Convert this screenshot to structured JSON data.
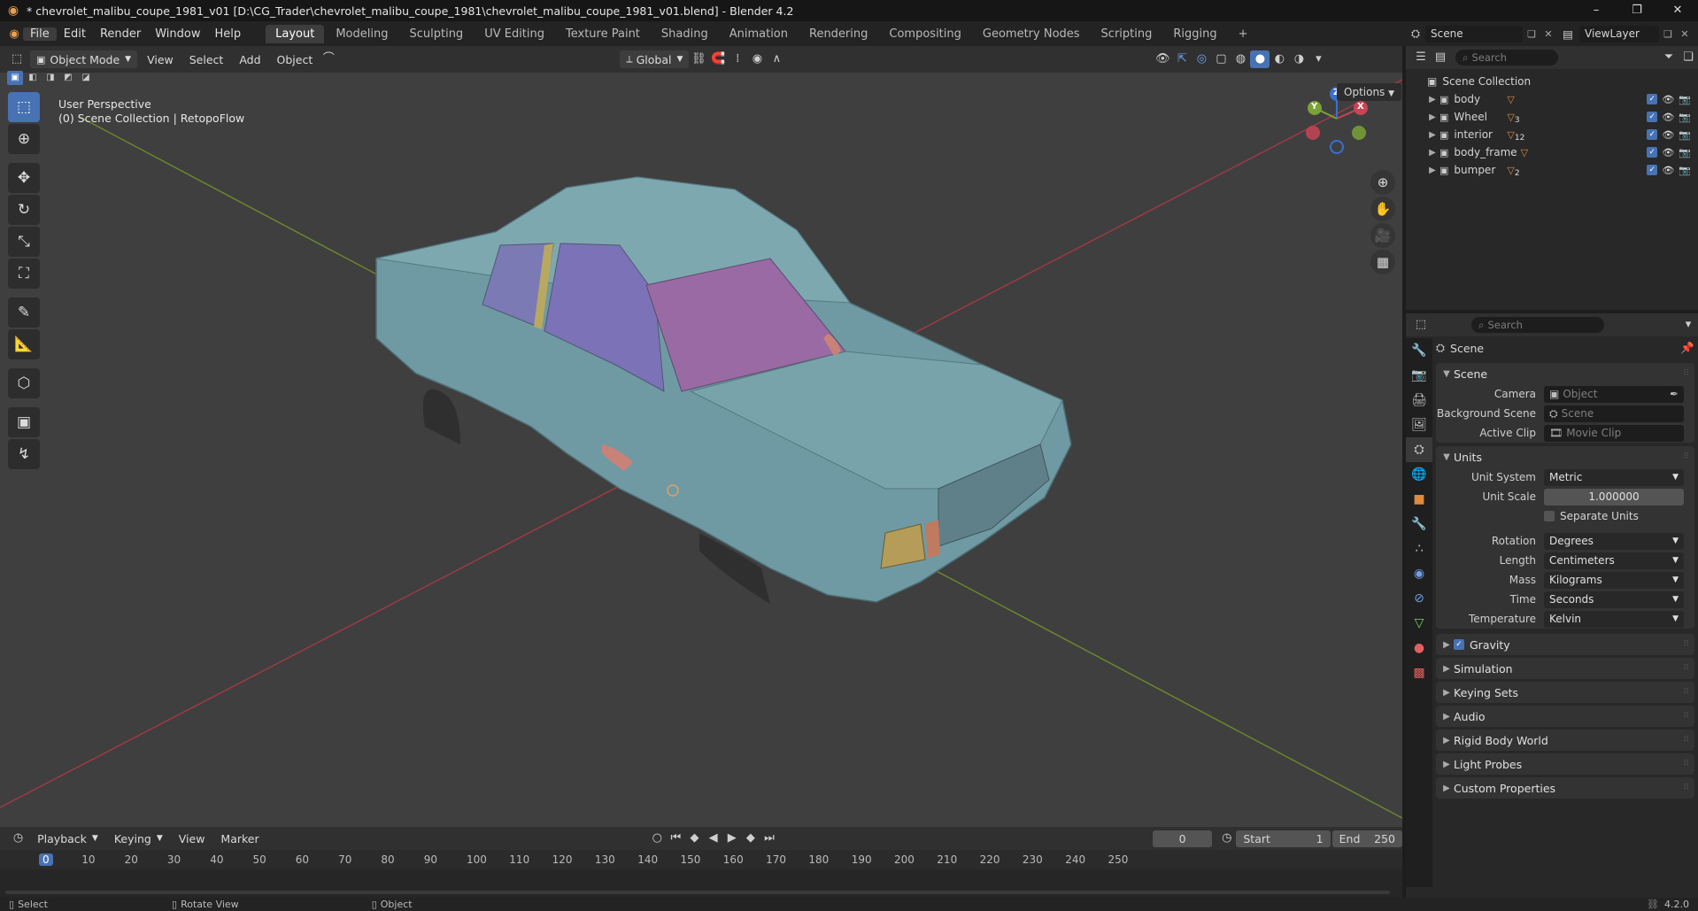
{
  "window": {
    "title": "* chevrolet_malibu_coupe_1981_v01 [D:\\CG_Trader\\chevrolet_malibu_coupe_1981\\chevrolet_malibu_coupe_1981_v01.blend] - Blender 4.2",
    "minimize": "–",
    "maximize": "❐",
    "close": "✕"
  },
  "menu": {
    "file": "File",
    "edit": "Edit",
    "render": "Render",
    "window": "Window",
    "help": "Help"
  },
  "workspaces": [
    "Layout",
    "Modeling",
    "Sculpting",
    "UV Editing",
    "Texture Paint",
    "Shading",
    "Animation",
    "Rendering",
    "Compositing",
    "Geometry Nodes",
    "Scripting",
    "Rigging"
  ],
  "workspace_add": "+",
  "scene_selector": {
    "scene": "Scene",
    "viewlayer": "ViewLayer"
  },
  "viewport_header": {
    "mode": "Object Mode",
    "view": "View",
    "select": "Select",
    "add": "Add",
    "object": "Object",
    "orientation": "Global",
    "options": "Options"
  },
  "overlay": {
    "perspective": "User Perspective",
    "collection": "(0) Scene Collection | RetopoFlow"
  },
  "gizmo": {
    "x": "X",
    "y": "Y",
    "z": "Z"
  },
  "outliner": {
    "search_placeholder": "Search",
    "root": "Scene Collection",
    "items": [
      {
        "name": "body",
        "badge": ""
      },
      {
        "name": "Wheel",
        "badge": "3"
      },
      {
        "name": "interior",
        "badge": "12"
      },
      {
        "name": "body_frame",
        "badge": ""
      },
      {
        "name": "bumper",
        "badge": "2"
      }
    ]
  },
  "properties": {
    "search_placeholder": "Search",
    "context": "Scene",
    "scene_panel": "Scene",
    "camera_label": "Camera",
    "camera_placeholder": "Object",
    "bgscene_label": "Background Scene",
    "bgscene_placeholder": "Scene",
    "clip_label": "Active Clip",
    "clip_placeholder": "Movie Clip",
    "units_panel": "Units",
    "unit_system_label": "Unit System",
    "unit_system": "Metric",
    "unit_scale_label": "Unit Scale",
    "unit_scale": "1.000000",
    "separate_units": "Separate Units",
    "rotation_label": "Rotation",
    "rotation": "Degrees",
    "length_label": "Length",
    "length": "Centimeters",
    "mass_label": "Mass",
    "mass": "Kilograms",
    "time_label": "Time",
    "time": "Seconds",
    "temperature_label": "Temperature",
    "temperature": "Kelvin",
    "collapsed": [
      "Simulation",
      "Keying Sets",
      "Audio",
      "Rigid Body World",
      "Light Probes",
      "Custom Properties"
    ],
    "gravity": "Gravity"
  },
  "timeline": {
    "playback": "Playback",
    "keying": "Keying",
    "view": "View",
    "marker": "Marker",
    "current_frame": "0",
    "start_label": "Start",
    "start": "1",
    "end_label": "End",
    "end": "250",
    "ruler": [
      "0",
      "10",
      "20",
      "30",
      "40",
      "50",
      "60",
      "70",
      "80",
      "90",
      "100",
      "110",
      "120",
      "130",
      "140",
      "150",
      "160",
      "170",
      "180",
      "190",
      "200",
      "210",
      "220",
      "230",
      "240",
      "250"
    ]
  },
  "status": {
    "select": "Select",
    "rotate": "Rotate View",
    "object": "Object",
    "version": "4.2.0"
  },
  "colors": {
    "accent": "#4772b3",
    "car_body": "#6f9aa3",
    "glass": "#8a5f9a",
    "x_axis": "#b23d4a",
    "y_axis": "#6e8a2c"
  }
}
